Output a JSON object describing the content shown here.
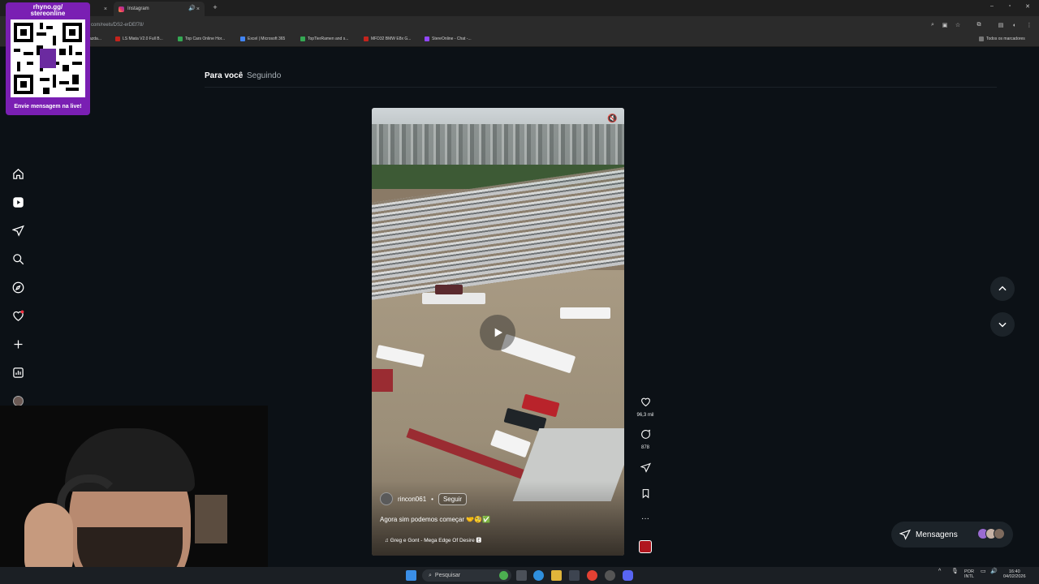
{
  "browser": {
    "tabs": [
      {
        "label": "",
        "close": "×"
      },
      {
        "label": "Instagram",
        "close": "×"
      }
    ],
    "new_tab": "+",
    "url": "com/reels/DS2-erDEf78/",
    "bookmarks": [
      {
        "label": "azda...",
        "color": "#3a3a3a"
      },
      {
        "label": "LS Miata V2.0 Full B...",
        "color": "#c4231c"
      },
      {
        "label": "Top Cars Online Hor...",
        "color": "#34a853"
      },
      {
        "label": "Excel | Microsoft 365",
        "color": "#4285f4"
      },
      {
        "label": "TopTierRamen and s...",
        "color": "#34a853"
      },
      {
        "label": "MFD32 BMW E8x G...",
        "color": "#c4231c"
      },
      {
        "label": "StereOnline - Chat -...",
        "color": "#9146ff"
      }
    ],
    "all_bookmarks": "Todos os marcadores"
  },
  "overlay": {
    "title_line1": "rhyno.gg/",
    "title_line2": "stereonline",
    "message": "Envie mensagem na live!"
  },
  "feed": {
    "tab_for_you": "Para você",
    "tab_following": "Seguindo"
  },
  "reel": {
    "username": "rincon061",
    "follow": "Seguir",
    "caption": "Agora sim podemos começar 🤝🧐✅",
    "music": "♫ Greg e Gont - Mega Edge Of Desire 🅴"
  },
  "actions": {
    "likes": "96,3 mil",
    "comments": "878"
  },
  "messages": {
    "label": "Mensagens"
  },
  "taskbar": {
    "search": "Pesquisar",
    "lang_line1": "POR",
    "lang_line2": "INTL",
    "time": "16:40",
    "date": "04/02/2026"
  },
  "colors": {
    "accent": "#7a1fb3",
    "background": "#0c1116",
    "notification": "#ff3040"
  }
}
